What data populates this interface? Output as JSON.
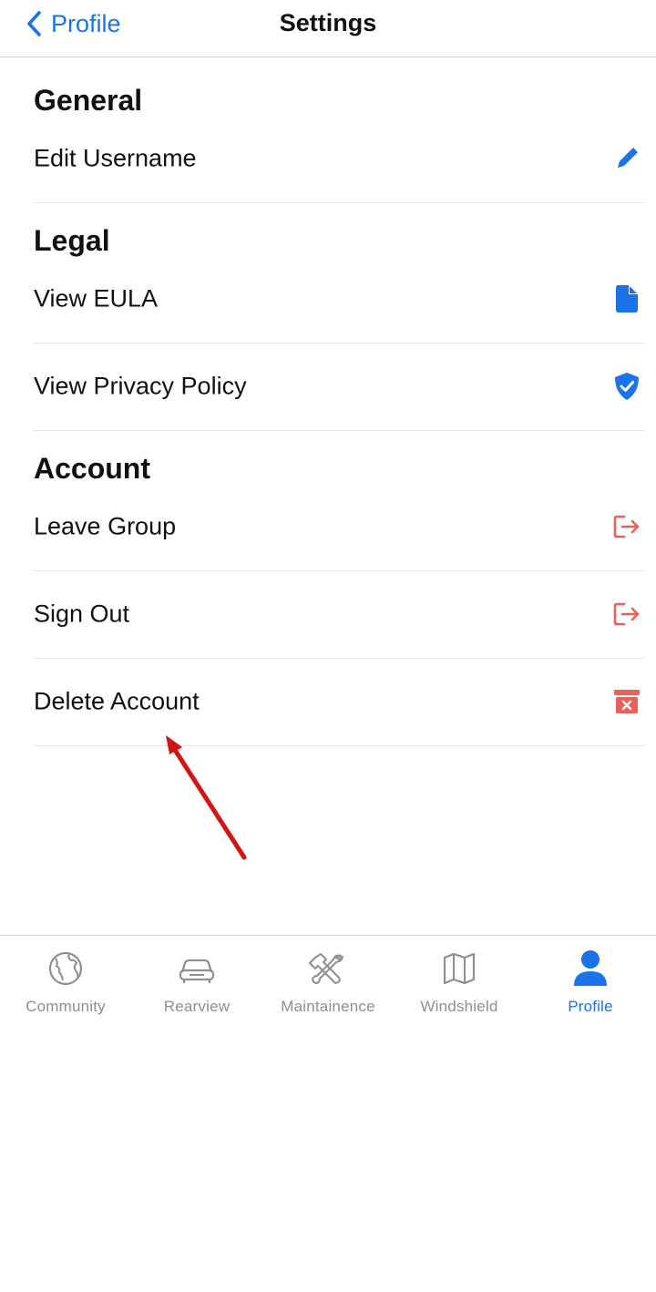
{
  "nav": {
    "back_label": "Profile",
    "title": "Settings"
  },
  "sections": {
    "general": {
      "header": "General",
      "items": [
        {
          "label": "Edit Username",
          "icon": "pencil-icon"
        }
      ]
    },
    "legal": {
      "header": "Legal",
      "items": [
        {
          "label": "View EULA",
          "icon": "document-icon"
        },
        {
          "label": "View Privacy Policy",
          "icon": "shield-check-icon"
        }
      ]
    },
    "account": {
      "header": "Account",
      "items": [
        {
          "label": "Leave Group",
          "icon": "exit-icon"
        },
        {
          "label": "Sign Out",
          "icon": "exit-icon"
        },
        {
          "label": "Delete Account",
          "icon": "trash-box-icon"
        }
      ]
    }
  },
  "tabbar": {
    "tabs": [
      {
        "label": "Community",
        "icon": "globe-icon",
        "active": false
      },
      {
        "label": "Rearview",
        "icon": "car-icon",
        "active": false
      },
      {
        "label": "Maintainence",
        "icon": "tools-icon",
        "active": false
      },
      {
        "label": "Windshield",
        "icon": "map-icon",
        "active": false
      },
      {
        "label": "Profile",
        "icon": "person-icon",
        "active": true
      }
    ]
  },
  "colors": {
    "accent_blue": "#1a73e8",
    "destructive_red": "#e8615a",
    "tab_inactive": "#8e8e93",
    "annotation_arrow": "#d41414"
  }
}
